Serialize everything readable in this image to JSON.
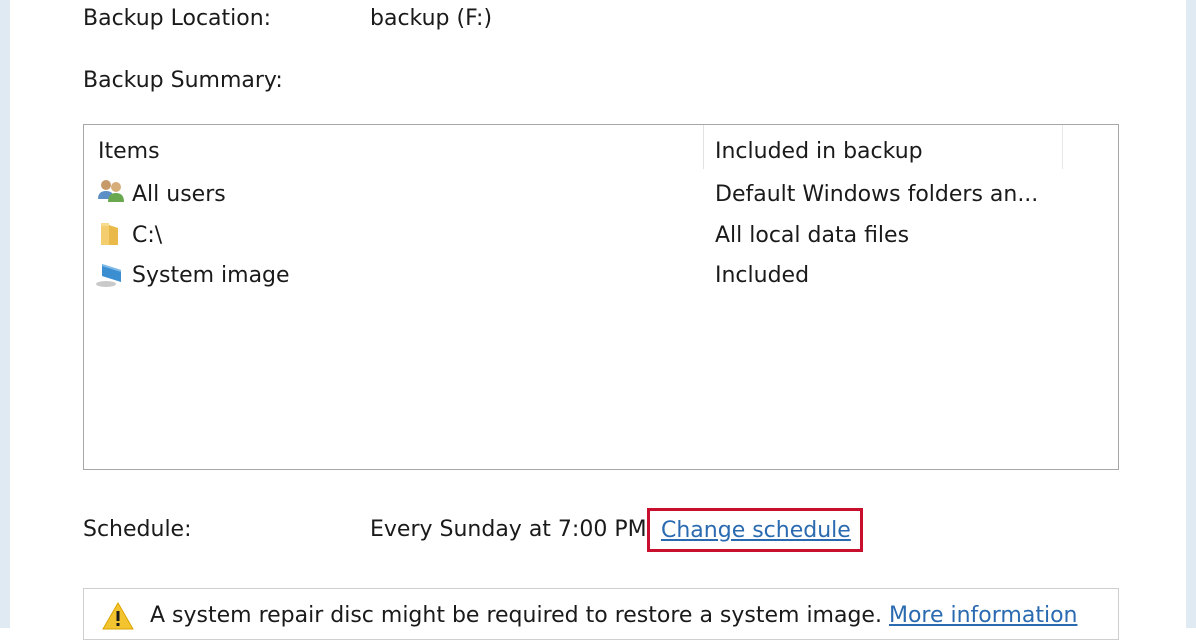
{
  "backup_location": {
    "label": "Backup Location:",
    "value": "backup (F:)"
  },
  "backup_summary": {
    "label": "Backup Summary:",
    "columns": [
      "Items",
      "Included in backup"
    ],
    "rows": [
      {
        "icon": "users-icon",
        "item": "All users",
        "included": "Default Windows folders an..."
      },
      {
        "icon": "folder-icon",
        "item": "C:\\",
        "included": "All local data files"
      },
      {
        "icon": "system-image-icon",
        "item": "System image",
        "included": "Included"
      }
    ]
  },
  "schedule": {
    "label": "Schedule:",
    "value": "Every Sunday at 7:00 PM",
    "change_link": "Change schedule",
    "highlight_color": "#c8102e"
  },
  "warning": {
    "icon": "warning-icon",
    "text": "A system repair disc might be required to restore a system image.",
    "link": "More information"
  }
}
